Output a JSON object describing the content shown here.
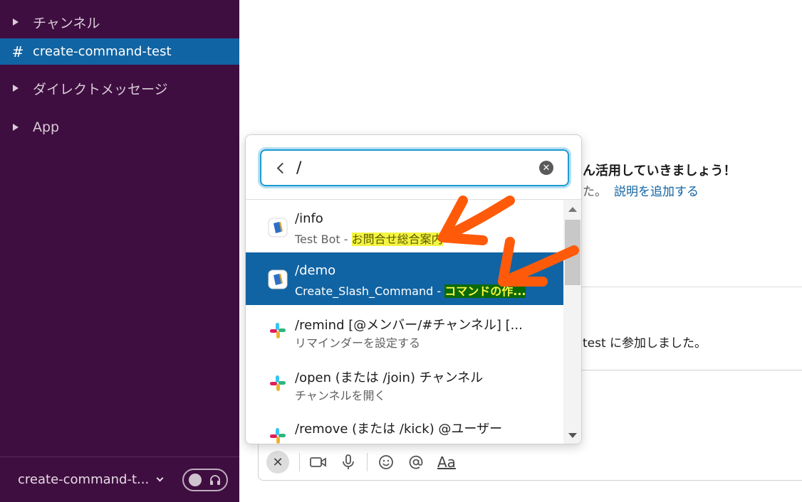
{
  "sidebar": {
    "sections": [
      {
        "label": "チャンネル"
      },
      {
        "label": "ダイレクトメッセージ"
      },
      {
        "label": "App"
      }
    ],
    "active_channel": {
      "hash": "#",
      "name": "create-command-test"
    },
    "footer": {
      "workspace": "create-command-t..."
    }
  },
  "main": {
    "intro_bold": "ん活用していきましょう！",
    "intro_sub": "た。",
    "add_description_link": "説明を追加する",
    "join_message": "test に参加しました。"
  },
  "popup": {
    "search_value": "/",
    "items": [
      {
        "command": "/info",
        "desc_prefix": "Test Bot - ",
        "desc_highlight": "お問合せ総合案内",
        "icon": "bot-app-icon"
      },
      {
        "command": "/demo",
        "desc_prefix": "Create_Slash_Command - ",
        "desc_highlight": "コマンドの作...",
        "icon": "bot-app-icon",
        "selected": true
      },
      {
        "command": "/remind [@メンバー/#チャンネル] [...",
        "desc": "リマインダーを設定する",
        "icon": "slack-logo-icon"
      },
      {
        "command": "/open (または /join) チャンネル",
        "desc": "チャンネルを開く",
        "icon": "slack-logo-icon"
      },
      {
        "command": "/remove (または /kick) @ユーザー",
        "icon": "slack-logo-icon"
      }
    ]
  },
  "composer": {
    "format_label": "Aa"
  },
  "colors": {
    "sidebar_bg": "#3f0e40",
    "active_bg": "#1164a3",
    "annotation_orange": "#ff5a0a",
    "highlight_yellow": "#f5f542",
    "highlight_green": "#0b6a08"
  }
}
